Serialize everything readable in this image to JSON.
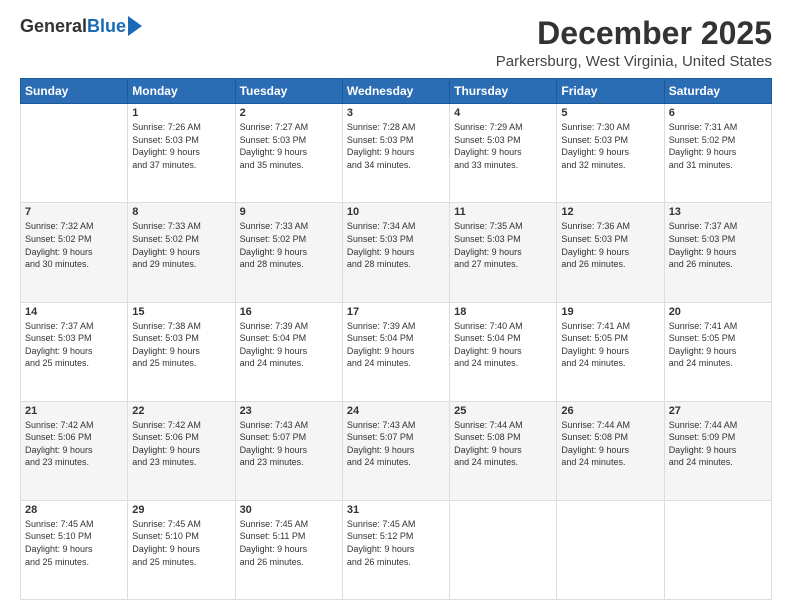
{
  "logo": {
    "general": "General",
    "blue": "Blue"
  },
  "header": {
    "month": "December 2025",
    "location": "Parkersburg, West Virginia, United States"
  },
  "weekdays": [
    "Sunday",
    "Monday",
    "Tuesday",
    "Wednesday",
    "Thursday",
    "Friday",
    "Saturday"
  ],
  "weeks": [
    [
      {
        "day": "",
        "info": ""
      },
      {
        "day": "1",
        "info": "Sunrise: 7:26 AM\nSunset: 5:03 PM\nDaylight: 9 hours\nand 37 minutes."
      },
      {
        "day": "2",
        "info": "Sunrise: 7:27 AM\nSunset: 5:03 PM\nDaylight: 9 hours\nand 35 minutes."
      },
      {
        "day": "3",
        "info": "Sunrise: 7:28 AM\nSunset: 5:03 PM\nDaylight: 9 hours\nand 34 minutes."
      },
      {
        "day": "4",
        "info": "Sunrise: 7:29 AM\nSunset: 5:03 PM\nDaylight: 9 hours\nand 33 minutes."
      },
      {
        "day": "5",
        "info": "Sunrise: 7:30 AM\nSunset: 5:03 PM\nDaylight: 9 hours\nand 32 minutes."
      },
      {
        "day": "6",
        "info": "Sunrise: 7:31 AM\nSunset: 5:02 PM\nDaylight: 9 hours\nand 31 minutes."
      }
    ],
    [
      {
        "day": "7",
        "info": "Sunrise: 7:32 AM\nSunset: 5:02 PM\nDaylight: 9 hours\nand 30 minutes."
      },
      {
        "day": "8",
        "info": "Sunrise: 7:33 AM\nSunset: 5:02 PM\nDaylight: 9 hours\nand 29 minutes."
      },
      {
        "day": "9",
        "info": "Sunrise: 7:33 AM\nSunset: 5:02 PM\nDaylight: 9 hours\nand 28 minutes."
      },
      {
        "day": "10",
        "info": "Sunrise: 7:34 AM\nSunset: 5:03 PM\nDaylight: 9 hours\nand 28 minutes."
      },
      {
        "day": "11",
        "info": "Sunrise: 7:35 AM\nSunset: 5:03 PM\nDaylight: 9 hours\nand 27 minutes."
      },
      {
        "day": "12",
        "info": "Sunrise: 7:36 AM\nSunset: 5:03 PM\nDaylight: 9 hours\nand 26 minutes."
      },
      {
        "day": "13",
        "info": "Sunrise: 7:37 AM\nSunset: 5:03 PM\nDaylight: 9 hours\nand 26 minutes."
      }
    ],
    [
      {
        "day": "14",
        "info": "Sunrise: 7:37 AM\nSunset: 5:03 PM\nDaylight: 9 hours\nand 25 minutes."
      },
      {
        "day": "15",
        "info": "Sunrise: 7:38 AM\nSunset: 5:03 PM\nDaylight: 9 hours\nand 25 minutes."
      },
      {
        "day": "16",
        "info": "Sunrise: 7:39 AM\nSunset: 5:04 PM\nDaylight: 9 hours\nand 24 minutes."
      },
      {
        "day": "17",
        "info": "Sunrise: 7:39 AM\nSunset: 5:04 PM\nDaylight: 9 hours\nand 24 minutes."
      },
      {
        "day": "18",
        "info": "Sunrise: 7:40 AM\nSunset: 5:04 PM\nDaylight: 9 hours\nand 24 minutes."
      },
      {
        "day": "19",
        "info": "Sunrise: 7:41 AM\nSunset: 5:05 PM\nDaylight: 9 hours\nand 24 minutes."
      },
      {
        "day": "20",
        "info": "Sunrise: 7:41 AM\nSunset: 5:05 PM\nDaylight: 9 hours\nand 24 minutes."
      }
    ],
    [
      {
        "day": "21",
        "info": "Sunrise: 7:42 AM\nSunset: 5:06 PM\nDaylight: 9 hours\nand 23 minutes."
      },
      {
        "day": "22",
        "info": "Sunrise: 7:42 AM\nSunset: 5:06 PM\nDaylight: 9 hours\nand 23 minutes."
      },
      {
        "day": "23",
        "info": "Sunrise: 7:43 AM\nSunset: 5:07 PM\nDaylight: 9 hours\nand 23 minutes."
      },
      {
        "day": "24",
        "info": "Sunrise: 7:43 AM\nSunset: 5:07 PM\nDaylight: 9 hours\nand 24 minutes."
      },
      {
        "day": "25",
        "info": "Sunrise: 7:44 AM\nSunset: 5:08 PM\nDaylight: 9 hours\nand 24 minutes."
      },
      {
        "day": "26",
        "info": "Sunrise: 7:44 AM\nSunset: 5:08 PM\nDaylight: 9 hours\nand 24 minutes."
      },
      {
        "day": "27",
        "info": "Sunrise: 7:44 AM\nSunset: 5:09 PM\nDaylight: 9 hours\nand 24 minutes."
      }
    ],
    [
      {
        "day": "28",
        "info": "Sunrise: 7:45 AM\nSunset: 5:10 PM\nDaylight: 9 hours\nand 25 minutes."
      },
      {
        "day": "29",
        "info": "Sunrise: 7:45 AM\nSunset: 5:10 PM\nDaylight: 9 hours\nand 25 minutes."
      },
      {
        "day": "30",
        "info": "Sunrise: 7:45 AM\nSunset: 5:11 PM\nDaylight: 9 hours\nand 26 minutes."
      },
      {
        "day": "31",
        "info": "Sunrise: 7:45 AM\nSunset: 5:12 PM\nDaylight: 9 hours\nand 26 minutes."
      },
      {
        "day": "",
        "info": ""
      },
      {
        "day": "",
        "info": ""
      },
      {
        "day": "",
        "info": ""
      }
    ]
  ]
}
